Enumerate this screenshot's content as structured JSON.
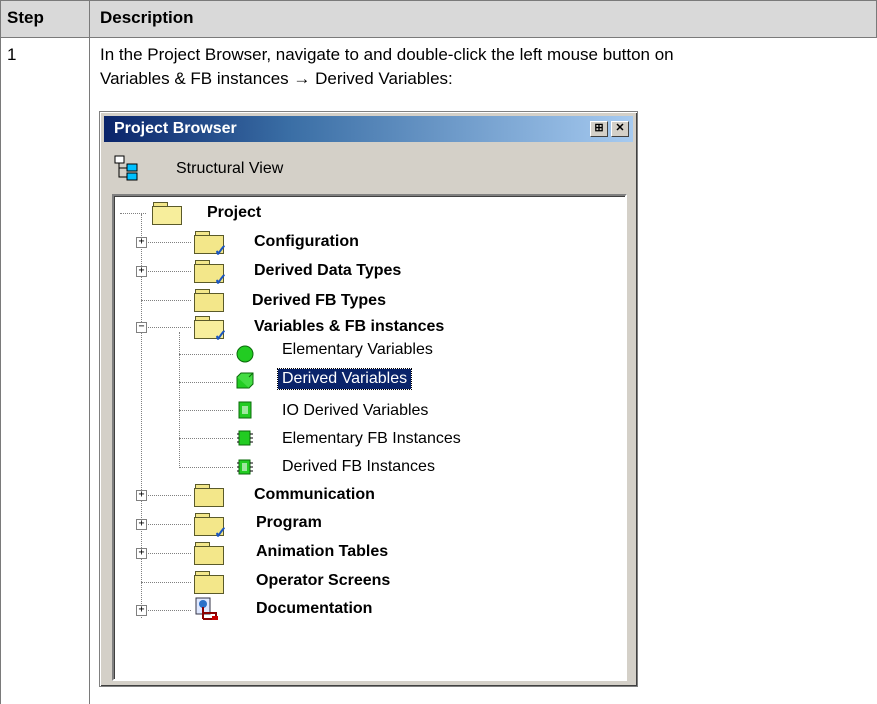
{
  "table": {
    "header": {
      "step": "Step",
      "description": "Description"
    },
    "row": {
      "step": "1",
      "intro_prefix": "In the ",
      "intro_bold1": "Project Browser",
      "intro_mid": ", navigate to and double-click the left mouse button on",
      "path_bold": "Variables & FB instances → Derived Variables",
      "path_suffix": ":"
    }
  },
  "browser": {
    "title": "Project Browser",
    "pin_icon": "pin-icon",
    "close_icon": "close-icon",
    "view_label": "Structural View",
    "tree": {
      "root": "Project",
      "items": [
        {
          "label": "Configuration",
          "expander": "+"
        },
        {
          "label": "Derived Data Types",
          "expander": "+"
        },
        {
          "label": "Derived FB Types",
          "expander": ""
        },
        {
          "label": "Variables & FB instances",
          "expander": "−"
        },
        {
          "label": "Communication",
          "expander": "+"
        },
        {
          "label": "Program",
          "expander": "+"
        },
        {
          "label": "Animation Tables",
          "expander": "+"
        },
        {
          "label": "Operator Screens",
          "expander": ""
        },
        {
          "label": "Documentation",
          "expander": "+"
        }
      ],
      "children": [
        {
          "label": "Elementary Variables"
        },
        {
          "label": "Derived Variables",
          "selected": true
        },
        {
          "label": "IO Derived Variables"
        },
        {
          "label": "Elementary FB Instances"
        },
        {
          "label": "Derived FB Instances"
        }
      ]
    }
  },
  "colors": {
    "header_bg": "#d9d9d9",
    "selection": "#0a246a",
    "folder": "#f3e78a",
    "leaf_green": "#22cc22"
  }
}
